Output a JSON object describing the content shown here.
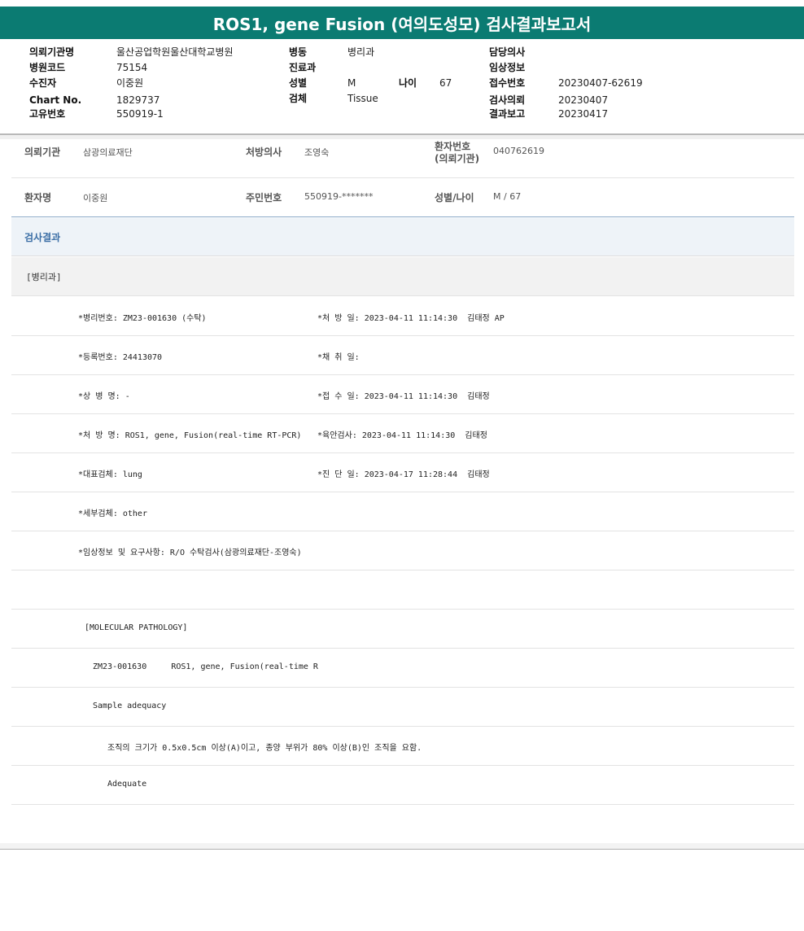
{
  "title": "ROS1, gene Fusion (여의도성모) 검사결과보고서",
  "header": {
    "col1": [
      {
        "label": "의뢰기관명",
        "value": "울산공업학원울산대학교병원"
      },
      {
        "label": "병원코드",
        "value": "75154"
      },
      {
        "label": "수진자",
        "value": "이중원"
      },
      {
        "label": "Chart No.",
        "value": "1829737"
      },
      {
        "label": "고유번호",
        "value": "550919-1"
      }
    ],
    "col2": [
      {
        "label": "병동",
        "value": "병리과"
      },
      {
        "label": "진료과",
        "value": ""
      },
      {
        "label": "성별",
        "value": "M"
      },
      {
        "label": "검체",
        "value": "Tissue"
      }
    ],
    "age": {
      "label": "나이",
      "value": "67"
    },
    "col3": [
      {
        "label": "담당의사",
        "value": ""
      },
      {
        "label": "임상정보",
        "value": ""
      },
      {
        "label": "접수번호",
        "value": "20230407-62619"
      },
      {
        "label": "검사의뢰",
        "value": "20230407"
      },
      {
        "label": "결과보고",
        "value": "20230417"
      }
    ]
  },
  "patient": {
    "institution_label": "의뢰기관",
    "institution": "삼광의료재단",
    "doctor_label": "처방의사",
    "doctor": "조영숙",
    "patient_no_label_1": "환자번호",
    "patient_no_label_2": "(의뢰기관)",
    "patient_no": "040762619",
    "name_label": "환자명",
    "name": "이중원",
    "rrn_label": "주민번호",
    "rrn": "550919-*******",
    "sexage_label": "성별/나이",
    "sexage": "M / 67"
  },
  "results": {
    "heading": "검사결과",
    "dept": "[병리과]",
    "lines": [
      {
        "left": "*병리번호: ZM23-001630 (수탁)",
        "right": "*처 방 일: 2023-04-11 11:14:30  김태정 AP"
      },
      {
        "left": "*등록번호: 24413070",
        "right": "*채 취 일:"
      },
      {
        "left": "*상 병 명: -",
        "right": "*접 수 일: 2023-04-11 11:14:30  김태정"
      },
      {
        "left": "*처 방 명: ROS1, gene, Fusion(real-time RT-PCR)",
        "right": "*육안검사: 2023-04-11 11:14:30  김태정"
      },
      {
        "left": "*대표검체: lung",
        "right": "*진 단 일: 2023-04-17 11:28:44  김태정"
      },
      {
        "left": "*세부검체: other",
        "right": ""
      },
      {
        "left": "*임상정보 및 요구사항: R/O 수탁검사(삼광의료재단-조영숙)",
        "right": ""
      }
    ],
    "molecular_title": "[MOLECULAR PATHOLOGY]",
    "molecular_case": "ZM23-001630     ROS1, gene, Fusion(real-time R",
    "sample_adequacy": "Sample adequacy",
    "criteria": "조직의 크기가 0.5x0.5cm 이상(A)이고, 종양 부위가 80% 이상(B)인 조직을 요함.",
    "adequacy_result": "Adequate"
  }
}
